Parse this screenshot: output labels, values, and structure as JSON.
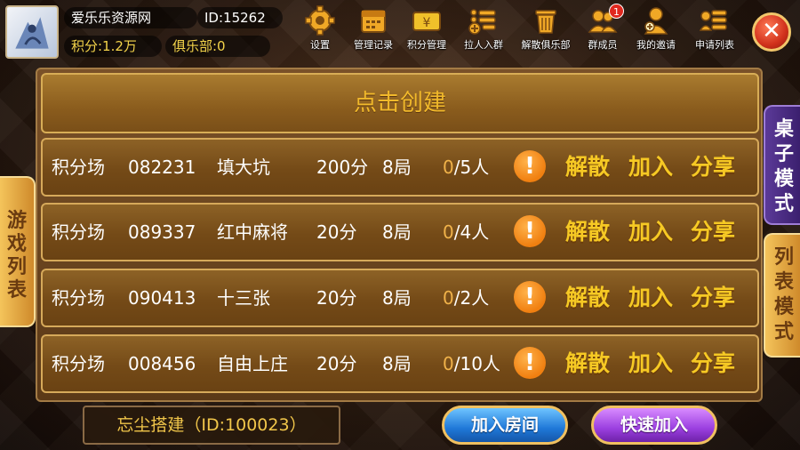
{
  "user": {
    "name": "爱乐乐资源网",
    "id_text": "ID:15262",
    "points_text": "积分:1.2万",
    "club_text": "俱乐部:0"
  },
  "toolbar": [
    {
      "label": "设置",
      "icon": "gear-icon"
    },
    {
      "label": "管理记录",
      "icon": "calendar-icon"
    },
    {
      "label": "积分管理",
      "icon": "yen-ticket-icon"
    },
    {
      "label": "拉人入群",
      "icon": "add-list-icon"
    },
    {
      "label": "解散俱乐部",
      "icon": "trash-icon"
    },
    {
      "label": "群成员",
      "icon": "members-icon",
      "badge": "1"
    },
    {
      "label": "我的邀请",
      "icon": "invite-icon"
    },
    {
      "label": "申请列表",
      "icon": "apply-list-icon"
    }
  ],
  "create_label": "点击创建",
  "rooms": [
    {
      "type": "积分场",
      "code": "082231",
      "game": "填大坑",
      "score": "200分",
      "rounds": "8局",
      "players_current": "0",
      "players_total": "/5人"
    },
    {
      "type": "积分场",
      "code": "089337",
      "game": "红中麻将",
      "score": "20分",
      "rounds": "8局",
      "players_current": "0",
      "players_total": "/4人"
    },
    {
      "type": "积分场",
      "code": "090413",
      "game": "十三张",
      "score": "20分",
      "rounds": "8局",
      "players_current": "0",
      "players_total": "/2人"
    },
    {
      "type": "积分场",
      "code": "008456",
      "game": "自由上庄",
      "score": "20分",
      "rounds": "8局",
      "players_current": "0",
      "players_total": "/10人"
    }
  ],
  "row_actions": {
    "info": "!",
    "dissolve": "解散",
    "join": "加入",
    "share": "分享"
  },
  "left_tab": "游戏列表",
  "right_tabs": {
    "desk_mode": "桌子模式",
    "list_mode": "列表模式"
  },
  "club_label": "忘尘搭建（ID:100023）",
  "buttons": {
    "join_room": "加入房间",
    "quick_join": "快速加入"
  },
  "close_symbol": "✕",
  "colors": {
    "accent_gold": "#f6c924",
    "join_blue": "#1f78d8",
    "quick_purple": "#9b3fe0",
    "close_red": "#d0301b"
  }
}
